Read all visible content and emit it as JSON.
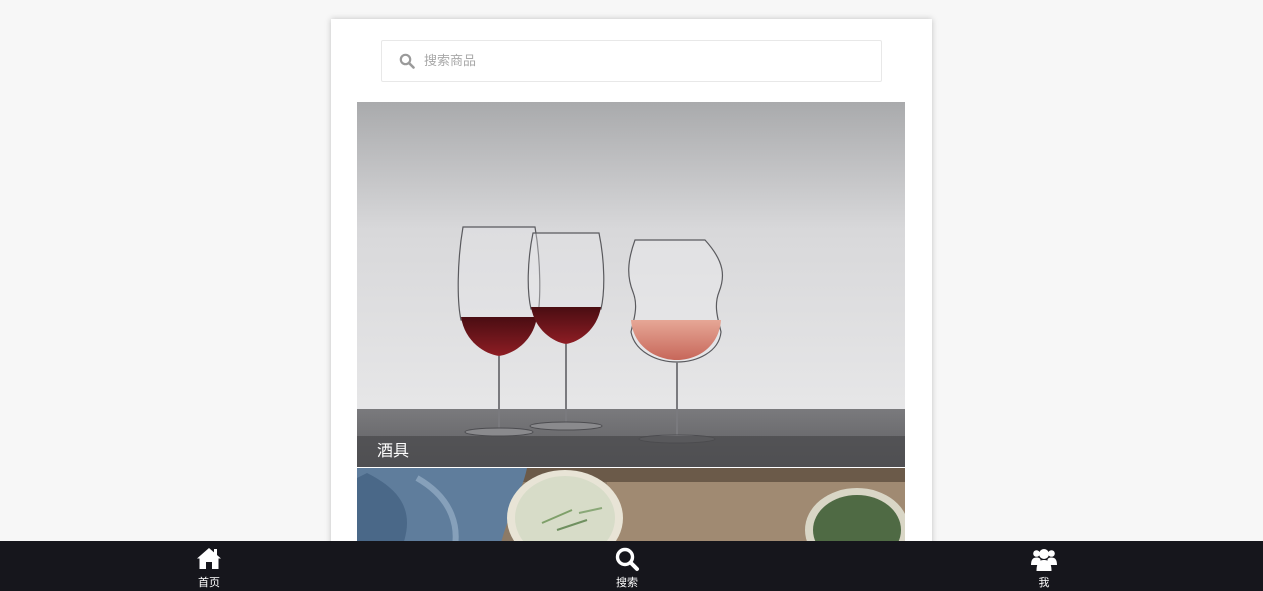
{
  "search": {
    "placeholder": "搜索商品",
    "icon": "search-icon"
  },
  "categories": [
    {
      "label": "酒具"
    },
    {
      "label": ""
    }
  ],
  "tabbar": {
    "items": [
      {
        "label": "首页",
        "icon": "home-icon"
      },
      {
        "label": "搜索",
        "icon": "search-icon"
      },
      {
        "label": "我",
        "icon": "users-icon"
      }
    ]
  },
  "colors": {
    "page_background": "#f7f7f7",
    "tabbar_background": "#16161c",
    "caption_overlay": "#4b4b4e",
    "placeholder_text": "#a8a8a8"
  }
}
